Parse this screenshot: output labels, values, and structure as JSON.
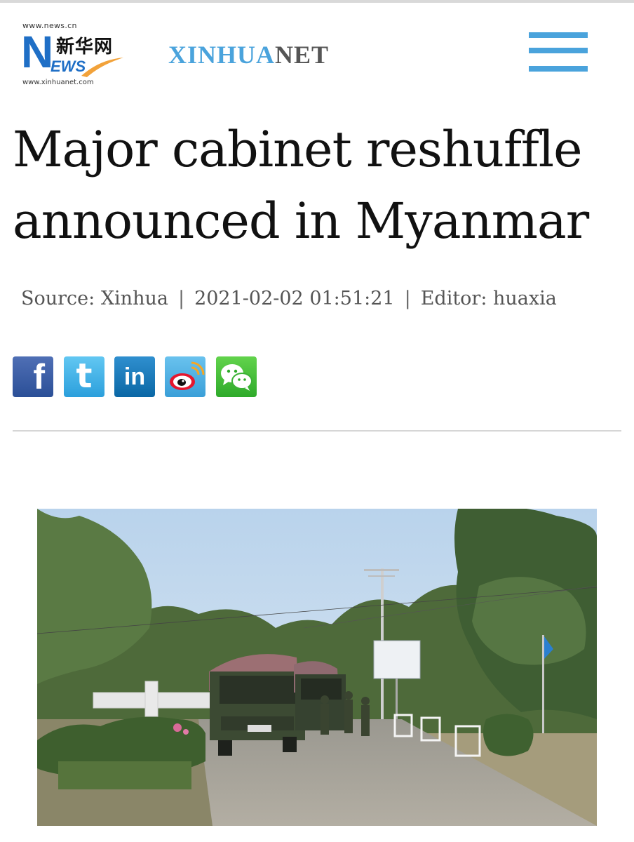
{
  "header": {
    "logo": {
      "url_top": "www.news.cn",
      "cn_text": "新华网",
      "n_letter": "N",
      "ews_text": "EWS",
      "url_bottom": "www.xinhuanet.com"
    },
    "brand_part1": "XINHUA",
    "brand_part2": "NET",
    "menu_icon": "hamburger-menu-icon"
  },
  "article": {
    "headline": "Major cabinet reshuffle announced in Myanmar",
    "source": "Source: Xinhua",
    "separator": "|",
    "datetime": "2021-02-02 01:51:21",
    "editor": "Editor: huaxia"
  },
  "share": {
    "facebook": "f",
    "twitter": "t",
    "linkedin": "in",
    "icons": [
      "facebook-icon",
      "twitter-icon",
      "linkedin-icon",
      "weibo-icon",
      "wechat-icon"
    ]
  },
  "colors": {
    "brand_blue": "#4aa3dc",
    "brand_gray": "#555555",
    "logo_blue": "#1f6fc6",
    "headline": "#111111",
    "meta": "#555555"
  }
}
